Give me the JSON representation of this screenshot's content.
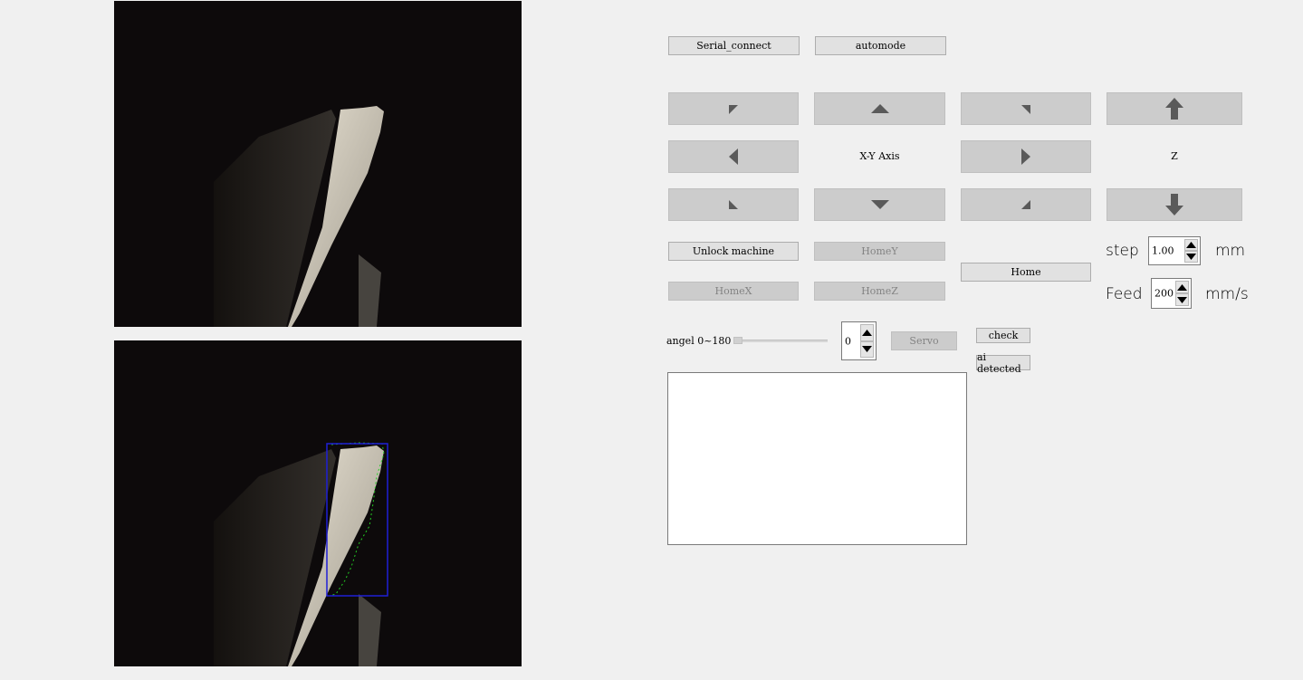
{
  "buttons": {
    "serial_connect": "Serial_connect",
    "automode": "automode",
    "unlock": "Unlock machine",
    "homeY": "HomeY",
    "homeX": "HomeX",
    "homeZ": "HomeZ",
    "home": "Home",
    "servo": "Servo",
    "check": "check",
    "ai_detected": "ai detected"
  },
  "labels": {
    "xy_axis": "X-Y Axis",
    "z": "Z",
    "step": "step",
    "step_unit": "mm",
    "feed": "Feed",
    "feed_unit": "mm/s",
    "angle": "angel 0~180"
  },
  "values": {
    "step": "1.00",
    "feed": "200",
    "angle": "0",
    "angle_slider_fraction": 0
  },
  "log": {
    "text": ""
  },
  "colors": {
    "background": "#f0f0f0",
    "button_bg": "#e1e1e1",
    "jog_bg": "#cccccc",
    "arrow": "#5a5a5a",
    "detection_box": "#1f1fd6",
    "contour": "#22cc22"
  },
  "icons": {
    "jog_up_left": "triangle-up-left-icon",
    "jog_up": "triangle-up-icon",
    "jog_up_right": "triangle-up-right-icon",
    "z_up": "arrow-up-icon",
    "jog_left": "triangle-left-icon",
    "jog_right": "triangle-right-icon",
    "jog_down_left": "triangle-down-left-icon",
    "jog_down": "triangle-down-icon",
    "jog_down_right": "triangle-down-right-icon",
    "z_down": "arrow-down-icon"
  }
}
